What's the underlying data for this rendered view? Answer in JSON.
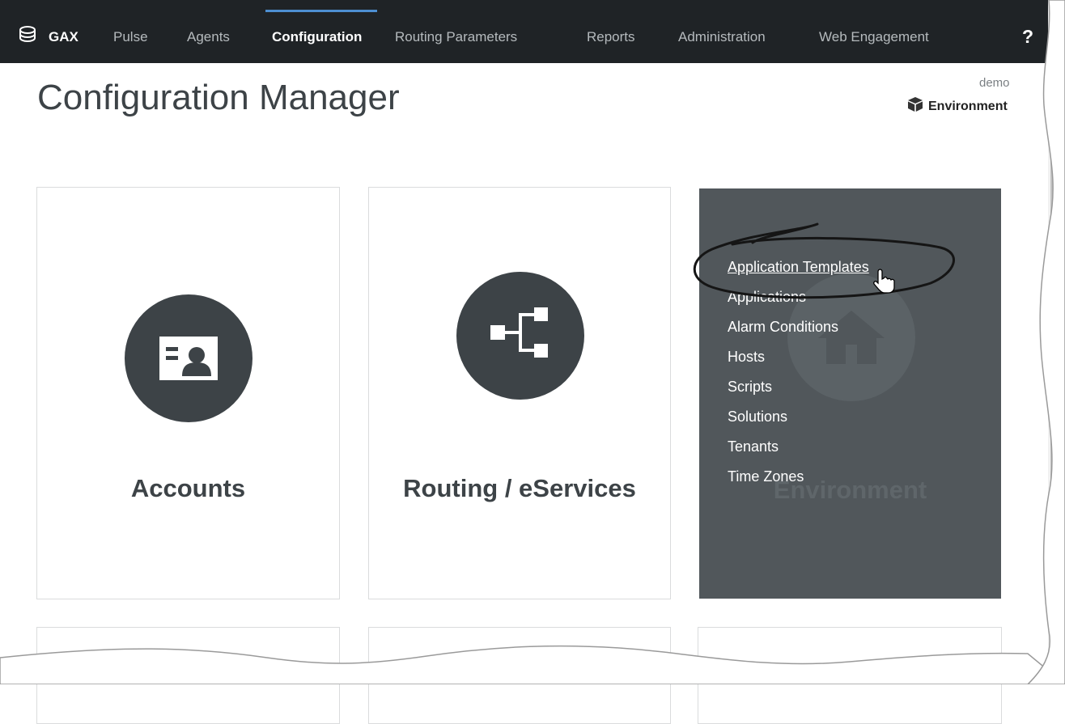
{
  "topnav": {
    "brand": "GAX",
    "items": [
      "Pulse",
      "Agents",
      "Configuration",
      "Routing Parameters",
      "Reports",
      "Administration",
      "Web Engagement"
    ],
    "active_item": "Configuration",
    "help_label": "?"
  },
  "header": {
    "title": "Configuration Manager",
    "user": "demo",
    "environment_label": "Environment"
  },
  "tiles": [
    {
      "title": "Accounts",
      "icon": "id-card-icon"
    },
    {
      "title": "Routing / eServices",
      "icon": "hierarchy-icon"
    },
    {
      "title": "Environment",
      "icon": "house-icon",
      "state": "hovered",
      "menu": [
        "Application Templates",
        "Applications",
        "Alarm Conditions",
        "Hosts",
        "Scripts",
        "Solutions",
        "Tenants",
        "Time Zones"
      ],
      "highlighted_item": "Application Templates"
    }
  ],
  "colors": {
    "nav_bg": "#1f2326",
    "accent": "#4d8fd1",
    "tile_icon": "#3d4347",
    "env_tile_bg": "#51575b"
  }
}
